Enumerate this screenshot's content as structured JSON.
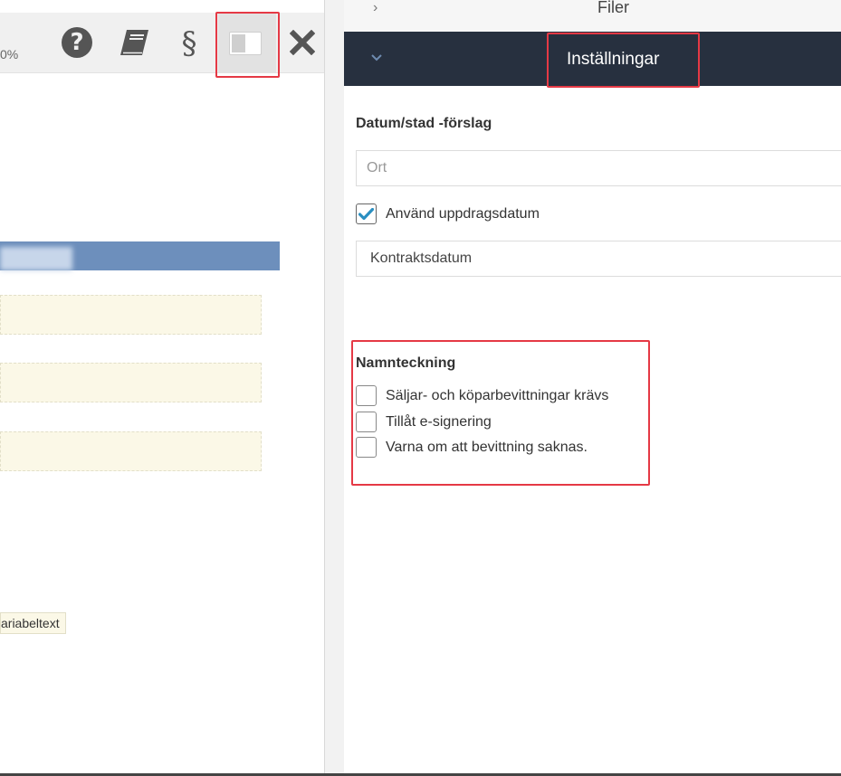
{
  "toolbar": {
    "zoom_text": "0%",
    "help_icon": "question-circle-icon",
    "book_icon": "book-icon",
    "section_symbol": "§",
    "toggle_icon": "panel-toggle-icon",
    "close_icon": "close-icon"
  },
  "editor": {
    "variable_tag": "ariabeltext"
  },
  "panel": {
    "files_label": "Filer",
    "settings_label": "Inställningar"
  },
  "date_section": {
    "title": "Datum/stad -förslag",
    "city_placeholder": "Ort",
    "city_value": "",
    "use_assignment_date_label": "Använd uppdragsdatum",
    "use_assignment_date_checked": true,
    "date_field_value": "Kontraktsdatum"
  },
  "signature_section": {
    "title": "Namnteckning",
    "options": [
      {
        "label": "Säljar- och köparbevittningar krävs",
        "checked": false
      },
      {
        "label": "Tillåt e-signering",
        "checked": false
      },
      {
        "label": "Varna om att bevittning saknas.",
        "checked": false
      }
    ]
  },
  "colors": {
    "header_dark": "#27303f",
    "highlight": "#e53945",
    "check_accent": "#2a8fc1",
    "blue_bar": "#6d8fbc",
    "field_yellow": "#fbf8e7"
  }
}
